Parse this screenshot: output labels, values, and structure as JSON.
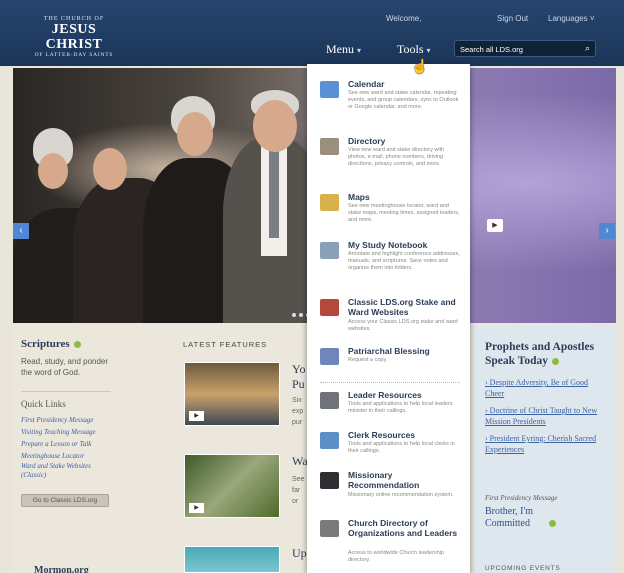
{
  "header": {
    "logo": {
      "line1": "THE CHURCH OF",
      "line2": "JESUS CHRIST",
      "line3": "OF LATTER-DAY SAINTS"
    },
    "welcome": "Welcome,",
    "sign_out": "Sign Out",
    "languages": "Languages",
    "nav": {
      "menu": "Menu",
      "tools": "Tools"
    },
    "search_placeholder": "Search all LDS.org"
  },
  "tools_menu": [
    {
      "title": "Calendar",
      "desc": "See new ward and stake calendar, repeating events, and group calendars, sync to Outlook or Google calendar, and more.",
      "icon": "calendar-icon",
      "color": "#5b8fd6"
    },
    {
      "title": "Directory",
      "desc": "View new ward and stake directory with photos, e-mail, phone numbers, driving directions, privacy controls, and more.",
      "icon": "directory-icon",
      "color": "#9a8f7c"
    },
    {
      "title": "Maps",
      "desc": "See new meetinghouse locator, ward and stake maps, meeting times, assigned leaders, and more.",
      "icon": "maps-icon",
      "color": "#d7b24a"
    },
    {
      "title": "My Study Notebook",
      "desc": "Annotate and highlight conference addresses, manuals, and scriptures. Save notes and organize them into folders.",
      "icon": "notebook-icon",
      "color": "#8aa0b8"
    },
    {
      "title": "Classic LDS.org Stake and Ward Websites",
      "desc": "Access your Classic LDS.org stake and ward websites.",
      "icon": "church-building-icon",
      "color": "#b5483d"
    },
    {
      "title": "Patriarchal Blessing",
      "desc": "Request a copy.",
      "icon": "document-icon",
      "color": "#6d88b8"
    },
    {
      "title": "Leader Resources",
      "desc": "Tools and applications to help local leaders minister in their callings.",
      "icon": "leader-resources-icon",
      "color": "#6f7278"
    },
    {
      "title": "Clerk Resources",
      "desc": "Tools and applications to help local clerks in their callings.",
      "icon": "clerk-resources-icon",
      "color": "#5a8fc7"
    },
    {
      "title": "Missionary Recommendation",
      "desc": "Missionary online recommendation system.",
      "icon": "missionary-icon",
      "color": "#2f2f33"
    },
    {
      "title": "Church Directory of Organizations and Leaders",
      "desc": "Access to worldwide Church leadership directory.",
      "icon": "organizations-directory-icon",
      "color": "#7a7a7a"
    }
  ],
  "scriptures": {
    "title": "Scriptures",
    "text": "Read, study, and ponder the word of God.",
    "quick_links_title": "Quick Links",
    "quick_links": [
      "First Presidency Message",
      "Visiting Teaching Message",
      "Prepare a Lesson or Talk",
      "Meetinghouse Locator",
      "Ward and Stake Websites (Classic)"
    ],
    "classic_button": "Go to Classic LDS.org",
    "mormon": "Mormon.org"
  },
  "features": {
    "title": "LATEST FEATURES",
    "items": [
      {
        "title_partial": "Yo",
        "title_partial2": "Pu",
        "text_lines": [
          "Six",
          "exp",
          "pur"
        ]
      },
      {
        "title_partial": "Wa",
        "text_lines": [
          "See",
          "far",
          "or"
        ]
      },
      {
        "title_partial": "Up"
      }
    ]
  },
  "right": {
    "title": "Prophets and Apostles Speak Today",
    "links": [
      "Despite Adversity, Be of Good Cheer",
      "Doctrine of Christ Taught to New Mission Presidents",
      "President Eyring: Cherish Sacred Experiences"
    ],
    "fp_label": "First Presidency Message",
    "fp_title": "Brother, I'm Committed",
    "upcoming": "UPCOMING EVENTS"
  }
}
